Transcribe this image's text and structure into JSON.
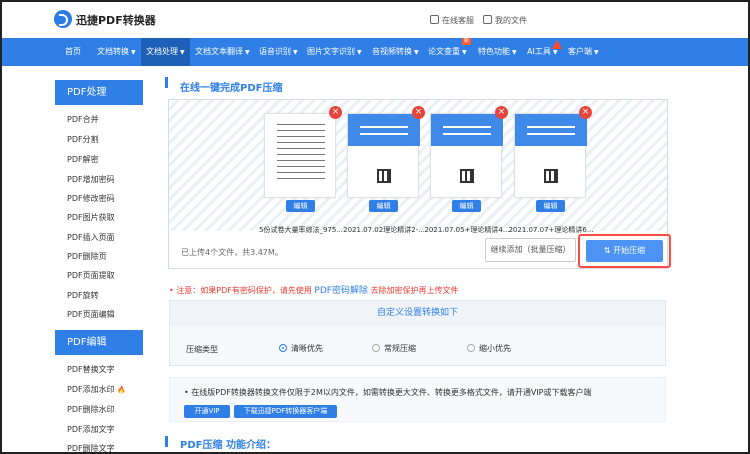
{
  "header": {
    "logo_text": "迅捷PDF转换器",
    "service": "在线客服",
    "my_files": "我的文件"
  },
  "nav": {
    "items": [
      {
        "label": "首页",
        "caret": ""
      },
      {
        "label": "文档转换",
        "caret": "▼"
      },
      {
        "label": "文档处理",
        "caret": "▼"
      },
      {
        "label": "文档文本翻译",
        "caret": "▼"
      },
      {
        "label": "语音识别",
        "caret": "▼"
      },
      {
        "label": "图片文字识别",
        "caret": "▼"
      },
      {
        "label": "音视频转换",
        "caret": "▼"
      },
      {
        "label": "论文查重",
        "caret": "▼"
      },
      {
        "label": "特色功能",
        "caret": "▼"
      },
      {
        "label": "AI工具",
        "caret": "▼"
      },
      {
        "label": "客户端",
        "caret": "▼"
      }
    ],
    "new_badge": "新"
  },
  "sidebar": {
    "pdf_process": "PDF处理",
    "process_items": [
      "PDF合并",
      "PDF分割",
      "PDF解密",
      "PDF增加密码",
      "PDF修改密码",
      "PDF图片获取",
      "PDF插入页面",
      "PDF删除页",
      "PDF页面提取",
      "PDF旋转",
      "PDF页面编辑"
    ],
    "pdf_edit": "PDF编辑",
    "edit_items": [
      "PDF替换文字",
      "PDF添加水印",
      "PDF删除水印",
      "PDF添加文字",
      "PDF删除文字"
    ]
  },
  "main": {
    "title": "在线一键完成PDF压缩",
    "files": [
      {
        "name": "5份试卷大量率综法_975...",
        "edit": "编辑",
        "remove": "×"
      },
      {
        "name": "2021.07.02理论精讲2-...",
        "edit": "编辑",
        "remove": "×"
      },
      {
        "name": "2021.07.05+理论精讲4...",
        "edit": "编辑",
        "remove": "×"
      },
      {
        "name": "2021.07.07+理论精讲6...",
        "edit": "编辑",
        "remove": "×"
      }
    ],
    "upload_info": "已上传4个文件，共3.47M。",
    "continue": "继续添加（批量压缩）",
    "start": "开始压缩",
    "notice_prefix": "注意：如果PDF有密码保护，请先使用",
    "notice_link": "PDF密码解除",
    "notice_suffix": "去除加密保护再上传文件",
    "settings_title": "自定义设置转换如下",
    "compress_type": "压缩类型",
    "options": [
      "清晰优先",
      "常规压缩",
      "缩小优先"
    ],
    "vip_text": "在线版PDF转换器转换文件仅限于2M以内文件，如需转换更大文件、转换更多格式文件，请开通VIP或下载客户端",
    "vip_button": "开通VIP",
    "download_button": "下载迅捷PDF转换器客户端",
    "intro_title": "PDF压缩 功能介绍："
  },
  "colors": {
    "primary": "#2f7fe6",
    "warning": "#f03a2f",
    "remove": "#e7453b"
  }
}
